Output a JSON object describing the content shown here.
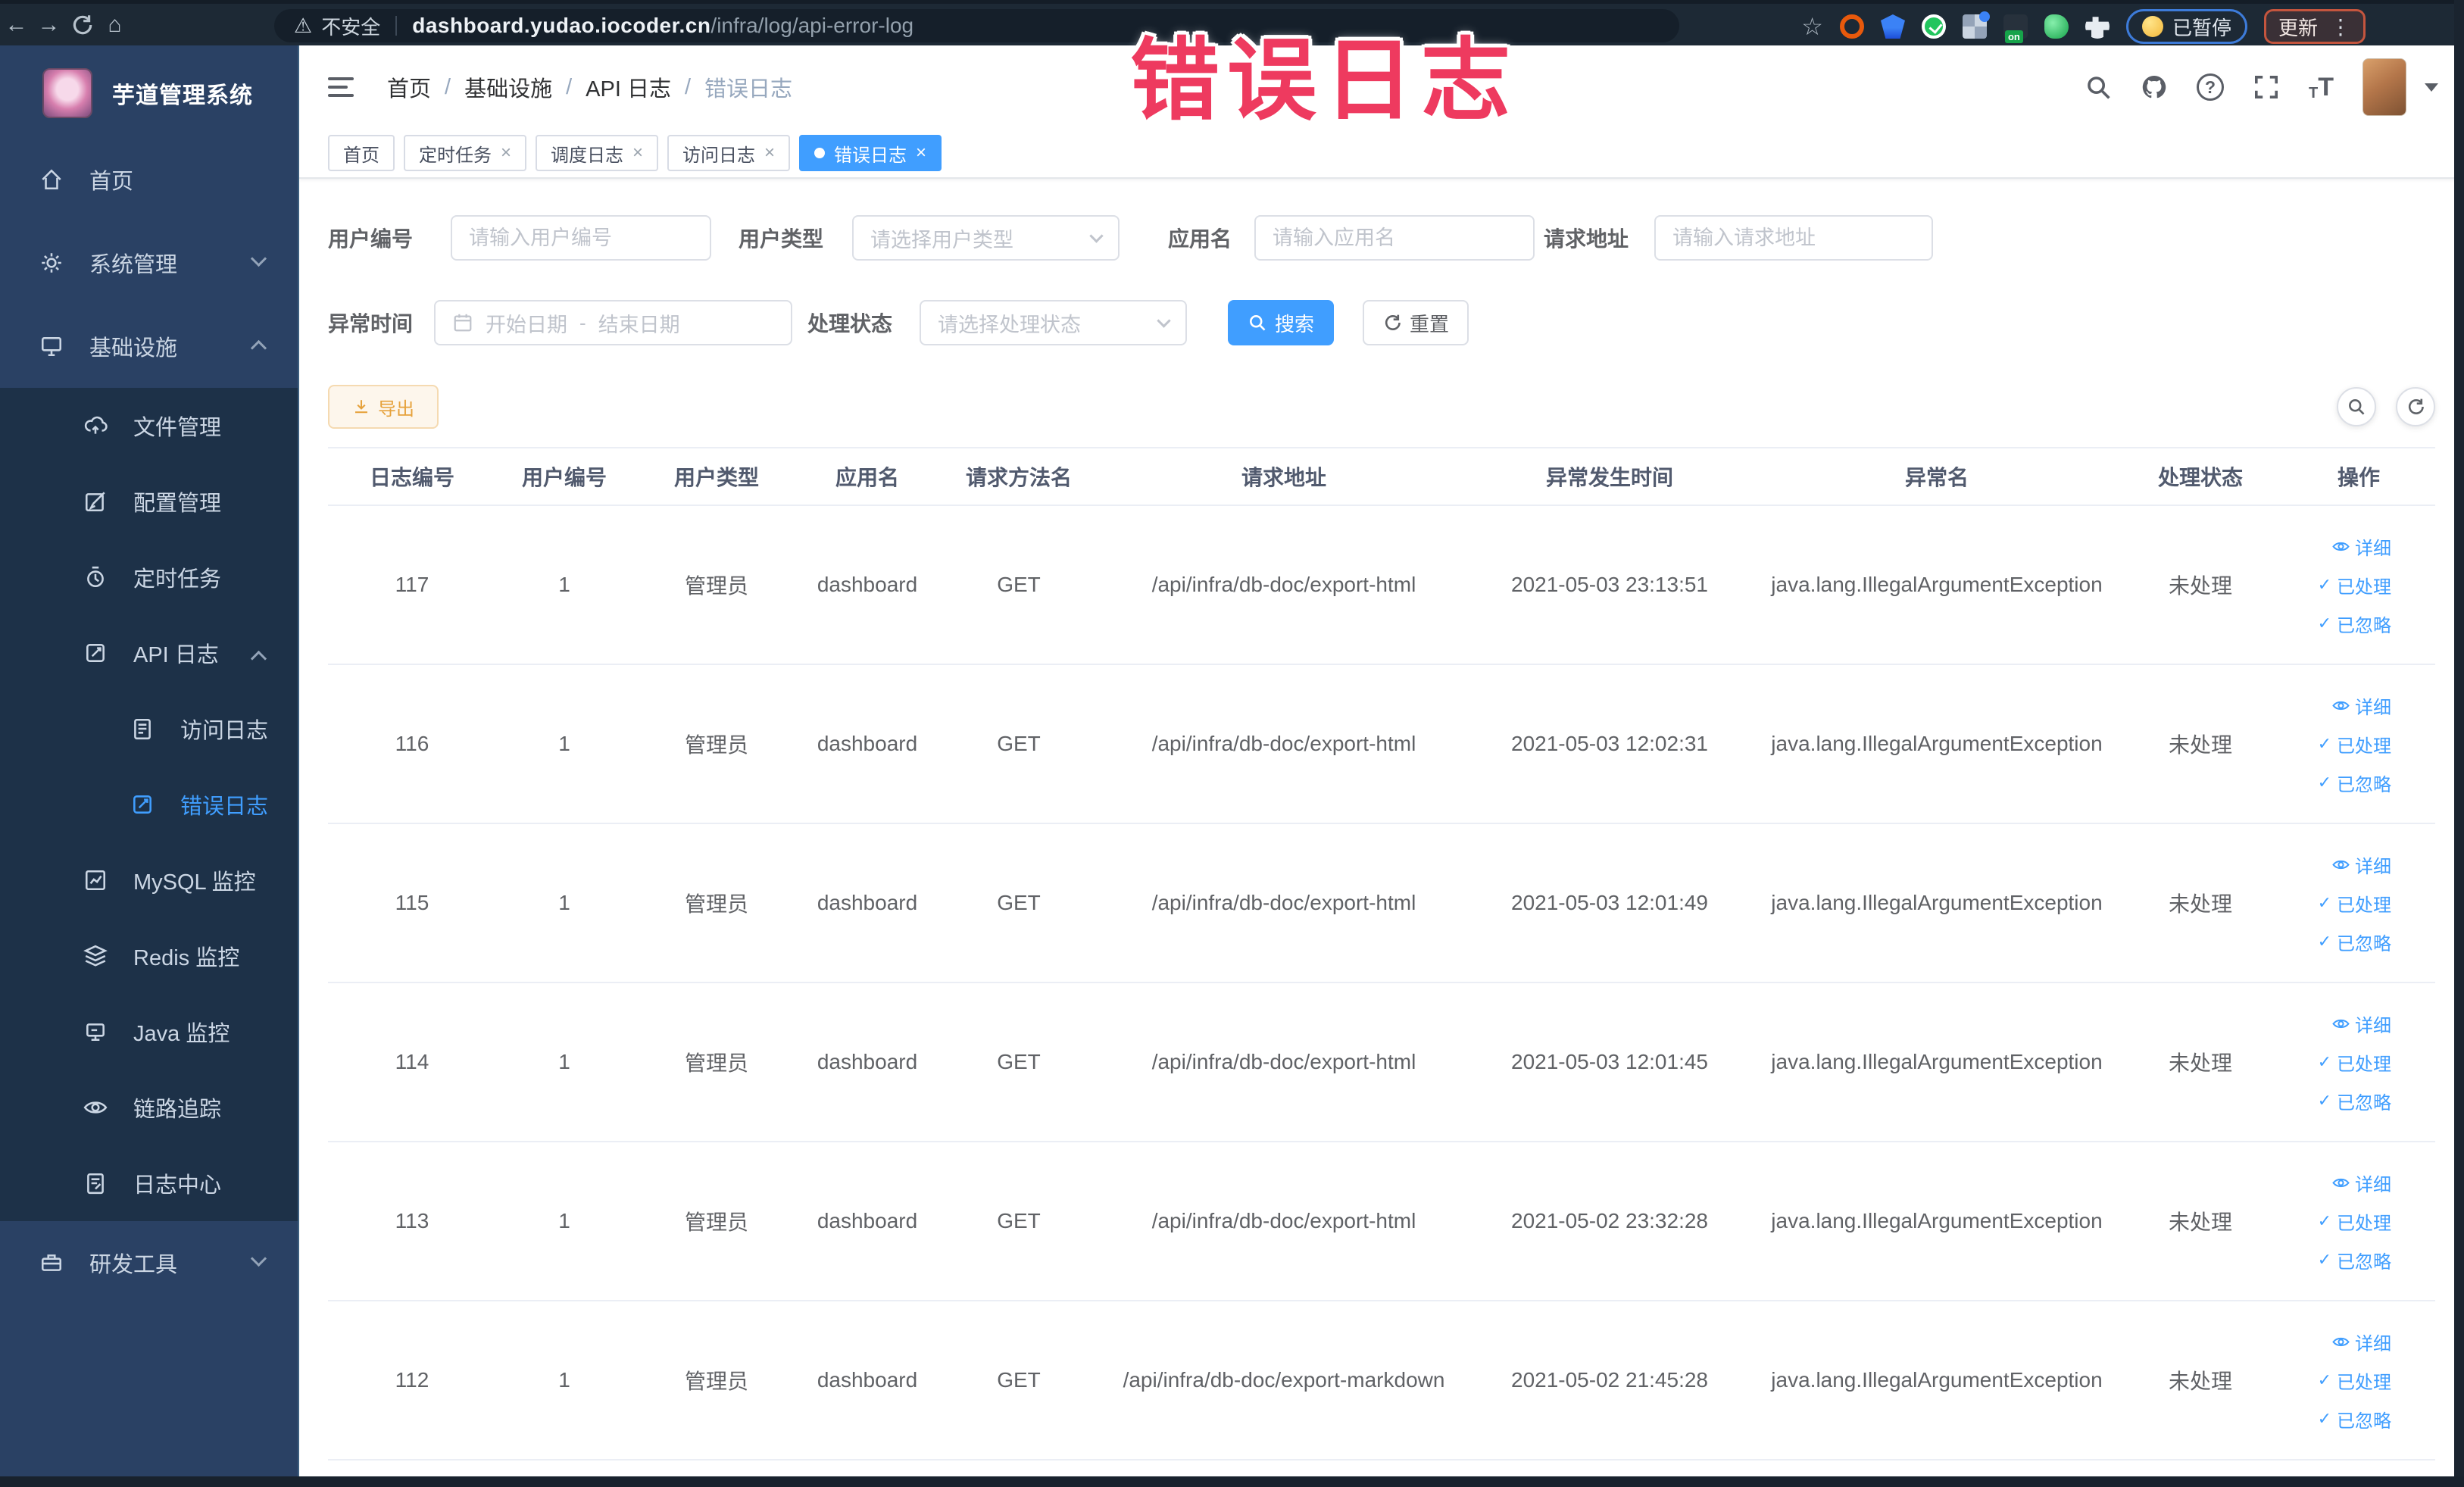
{
  "colors": {
    "accent": "#409eff",
    "warning": "#e6a23c",
    "annotation_pink": "#ee3a5f",
    "sidebar_bg": "#2a4164",
    "submenu_bg": "#1d3148"
  },
  "annotation": {
    "text": "错误日志"
  },
  "icons": {
    "back": "←",
    "forward": "→",
    "home": "⌂",
    "warning": "⚠",
    "star": "☆",
    "kebab": "⋮",
    "check": "✓",
    "close": "×",
    "question": "?",
    "fontsize": "T"
  },
  "browser": {
    "security_label": "不安全",
    "url_host": "dashboard.yudao.iocoder.cn",
    "url_path": "/infra/log/api-error-log",
    "extension_badge": "on",
    "paused_label": "已暂停",
    "update_label": "更新"
  },
  "sidebar": {
    "title": "芋道管理系统",
    "menu": {
      "home": "首页",
      "system": "系统管理",
      "infra": "基础设施",
      "file": "文件管理",
      "config": "配置管理",
      "job": "定时任务",
      "apilog": "API 日志",
      "accesslog": "访问日志",
      "errorlog": "错误日志",
      "mysql": "MySQL 监控",
      "redis": "Redis 监控",
      "java": "Java 监控",
      "trace": "链路追踪",
      "logcenter": "日志中心",
      "devtool": "研发工具"
    }
  },
  "header": {
    "breadcrumb": [
      "首页",
      "基础设施",
      "API 日志",
      "错误日志"
    ]
  },
  "tags": {
    "items": [
      {
        "label": "首页"
      },
      {
        "label": "定时任务"
      },
      {
        "label": "调度日志"
      },
      {
        "label": "访问日志"
      },
      {
        "label": "错误日志"
      }
    ]
  },
  "filters": {
    "user_id": {
      "label": "用户编号",
      "placeholder": "请输入用户编号",
      "value": ""
    },
    "user_type": {
      "label": "用户类型",
      "placeholder": "请选择用户类型"
    },
    "app_name": {
      "label": "应用名",
      "placeholder": "请输入应用名",
      "value": ""
    },
    "request_url": {
      "label": "请求地址",
      "placeholder": "请输入请求地址",
      "value": ""
    },
    "exception_time": {
      "label": "异常时间",
      "start_placeholder": "开始日期",
      "separator": "-",
      "end_placeholder": "结束日期"
    },
    "process_status": {
      "label": "处理状态",
      "placeholder": "请选择处理状态"
    },
    "search_label": "搜索",
    "reset_label": "重置"
  },
  "toolbar": {
    "export_label": "导出"
  },
  "table": {
    "columns": [
      "日志编号",
      "用户编号",
      "用户类型",
      "应用名",
      "请求方法名",
      "请求地址",
      "异常发生时间",
      "异常名",
      "处理状态",
      "操作"
    ],
    "action_labels": {
      "detail": "详细",
      "processed": "已处理",
      "ignored": "已忽略"
    },
    "rows": [
      {
        "id": "117",
        "user_id": "1",
        "user_type": "管理员",
        "app": "dashboard",
        "method": "GET",
        "url": "/api/infra/db-doc/export-html",
        "time": "2021-05-03 23:13:51",
        "exception": "java.lang.IllegalArgumentException",
        "status": "未处理"
      },
      {
        "id": "116",
        "user_id": "1",
        "user_type": "管理员",
        "app": "dashboard",
        "method": "GET",
        "url": "/api/infra/db-doc/export-html",
        "time": "2021-05-03 12:02:31",
        "exception": "java.lang.IllegalArgumentException",
        "status": "未处理"
      },
      {
        "id": "115",
        "user_id": "1",
        "user_type": "管理员",
        "app": "dashboard",
        "method": "GET",
        "url": "/api/infra/db-doc/export-html",
        "time": "2021-05-03 12:01:49",
        "exception": "java.lang.IllegalArgumentException",
        "status": "未处理"
      },
      {
        "id": "114",
        "user_id": "1",
        "user_type": "管理员",
        "app": "dashboard",
        "method": "GET",
        "url": "/api/infra/db-doc/export-html",
        "time": "2021-05-03 12:01:45",
        "exception": "java.lang.IllegalArgumentException",
        "status": "未处理"
      },
      {
        "id": "113",
        "user_id": "1",
        "user_type": "管理员",
        "app": "dashboard",
        "method": "GET",
        "url": "/api/infra/db-doc/export-html",
        "time": "2021-05-02 23:32:28",
        "exception": "java.lang.IllegalArgumentException",
        "status": "未处理"
      },
      {
        "id": "112",
        "user_id": "1",
        "user_type": "管理员",
        "app": "dashboard",
        "method": "GET",
        "url": "/api/infra/db-doc/export-markdown",
        "time": "2021-05-02 21:45:28",
        "exception": "java.lang.IllegalArgumentException",
        "status": "未处理"
      }
    ]
  }
}
